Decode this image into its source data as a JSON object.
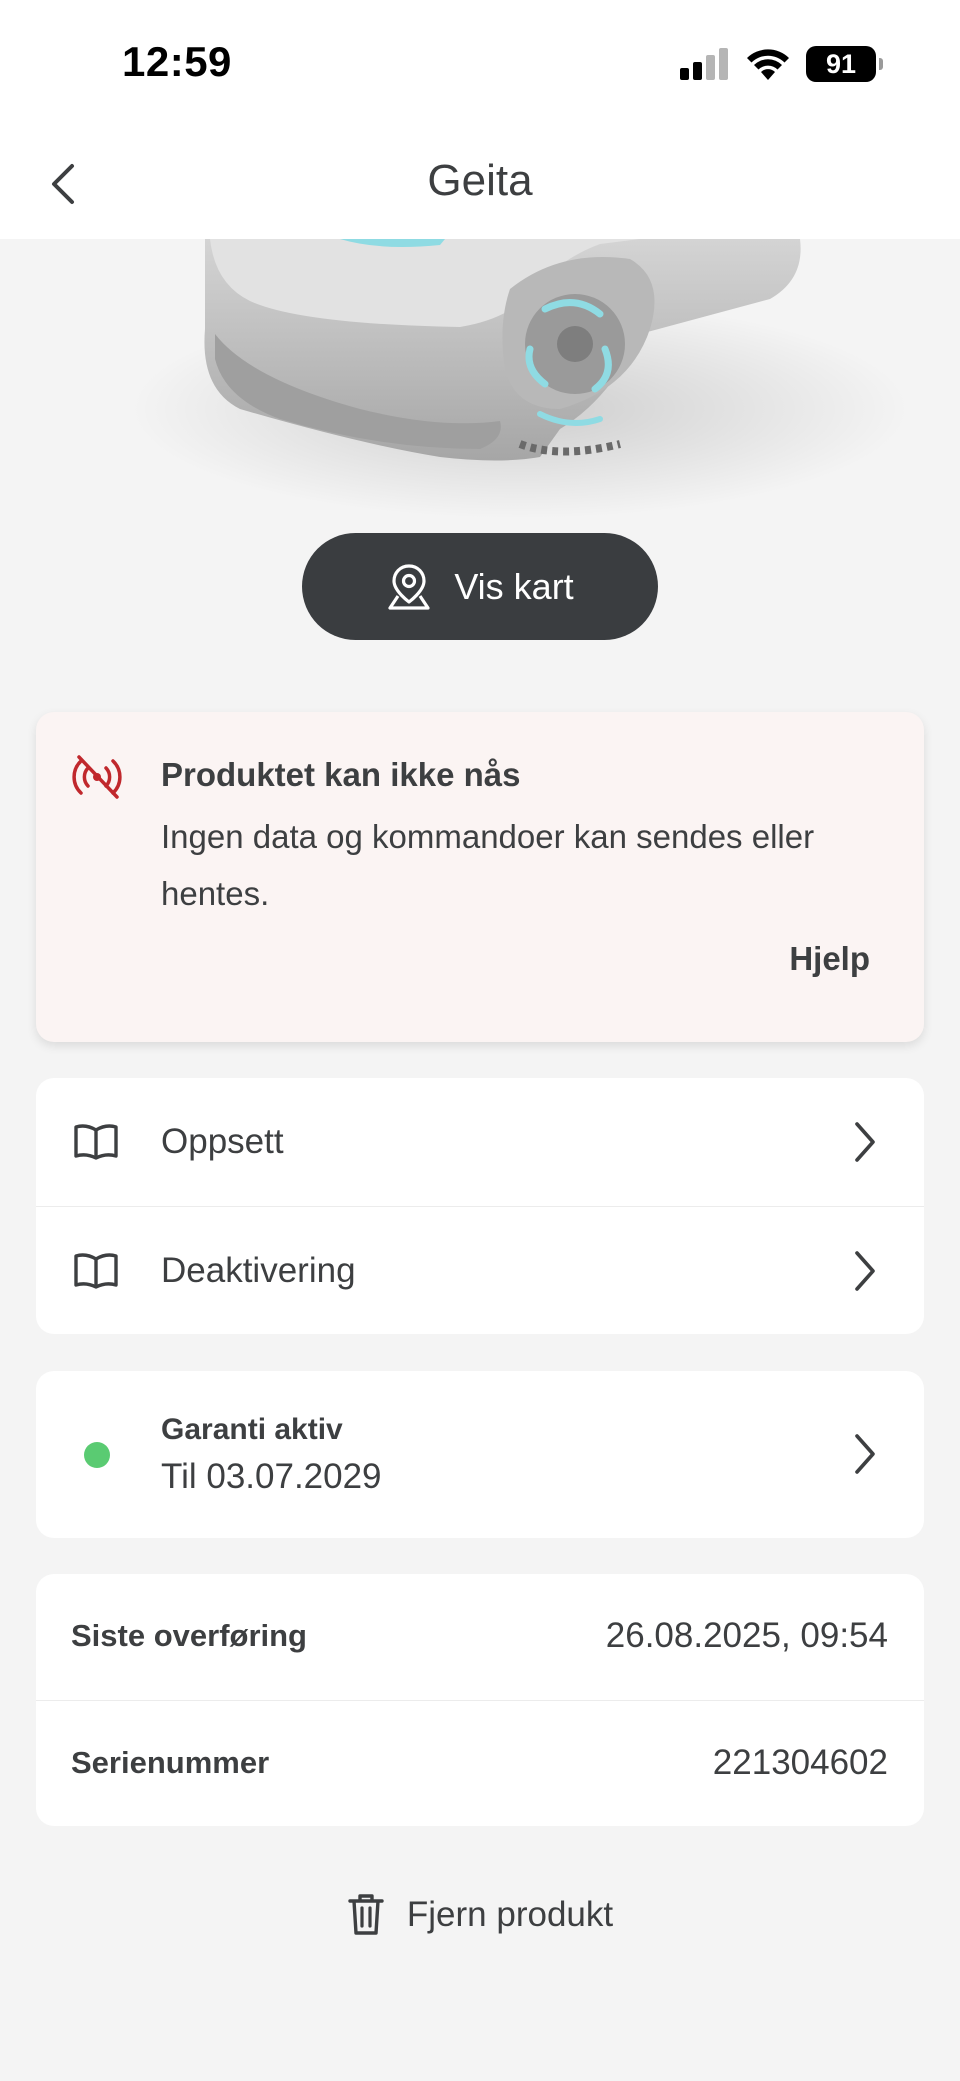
{
  "status_bar": {
    "time": "12:59",
    "battery": "91"
  },
  "nav": {
    "title": "Geita"
  },
  "map_button": {
    "label": "Vis kart"
  },
  "alert": {
    "title": "Produktet kan ikke nås",
    "body": "Ingen data og kommandoer kan sendes eller hentes.",
    "help": "Hjelp"
  },
  "guides": [
    {
      "label": "Oppsett",
      "icon": "book-icon"
    },
    {
      "label": "Deaktivering",
      "icon": "book-icon"
    }
  ],
  "warranty": {
    "title": "Garanti aktiv",
    "subtitle": "Til 03.07.2029",
    "status_color": "#5acb72"
  },
  "info": [
    {
      "label": "Siste overføring",
      "value": "26.08.2025, 09:54"
    },
    {
      "label": "Serienummer",
      "value": "221304602"
    }
  ],
  "remove": {
    "label": "Fjern produkt"
  },
  "colors": {
    "alert_icon": "#c0282d",
    "button_bg": "#3a3d40",
    "accent": "#7fd3dc"
  }
}
